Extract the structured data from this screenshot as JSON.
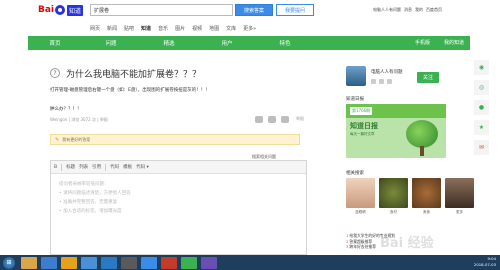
{
  "topbar": {
    "logo_bai": "Bai",
    "logo_tag": "知道",
    "search_value": "扩展卷",
    "search_button": "搜索答案",
    "ask_button": "我要提问",
    "user_links": [
      "电脑人人有问题",
      "消息",
      "我的",
      "百度首页"
    ]
  },
  "subnav": [
    "网页",
    "新闻",
    "贴吧",
    "知道",
    "音乐",
    "图片",
    "视频",
    "地图",
    "文库",
    "更多»"
  ],
  "green_nav": {
    "items": [
      "首页",
      "问题",
      "精选",
      "用户",
      "特色"
    ],
    "right_items": [
      "手机版",
      "我的知道"
    ]
  },
  "question": {
    "mark": "?",
    "title": "为什么我电脑不能加扩展卷？？？",
    "description": "打开管理-磁盘管理后右键一个盘（如：E盘），出现图的扩展卷按扭是灰的！！！",
    "follow": "肿么办？？！！",
    "meta": "Weingon | 浏览 3072 次 | 举报",
    "report_label": "举报",
    "notice": "我有更好的答案",
    "search_answers": "搜索相关问题"
  },
  "editor": {
    "toolbar": [
      "B",
      "标题",
      "列表",
      "引用",
      "代码",
      "模板",
      "代码 ▾"
    ],
    "placeholder_lines": [
      "提问者采纳率较低问题：",
      "• 请将问题描述清楚，方便他人回答",
      "• 准确并完整回答，无需重复",
      "• 加入合适的标签，增加曝光度"
    ]
  },
  "sidebar": {
    "user_name": "电脑人人有问题",
    "follow_button": "关注",
    "card_title": "知道日报",
    "daily_badge": "第1766期",
    "daily_title": "知道日报",
    "daily_sub": "每天一篇好文章",
    "rec_title": "相关搜索",
    "rec_captions": [
      "蓝眼睛",
      "食材",
      "美食",
      "更多"
    ],
    "hot_list": [
      {
        "num": "1",
        "text": "给我大学生的好的专业规划"
      },
      {
        "num": "2",
        "text": "答案超级推荐"
      },
      {
        "num": "3",
        "text": "跨年好去处推荐"
      }
    ]
  },
  "rail": {
    "icons": [
      "wechat-icon",
      "weibo-icon",
      "qq-icon",
      "star-icon",
      "note-icon"
    ],
    "hot_badge": "2"
  },
  "taskbar": {
    "time": "9:04",
    "date": "2018-07-03"
  },
  "watermark": "Bai 经验"
}
